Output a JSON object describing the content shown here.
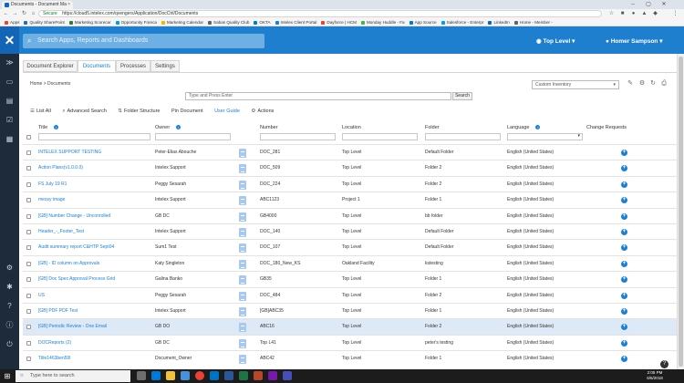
{
  "browser": {
    "tab_title": "Documents - Document Ma",
    "secure_label": "Secure",
    "url": "https://cloud5.intelex.com/qvengers/Application/DocCtrl/Documents",
    "bookmarks": [
      {
        "label": "Apps",
        "color": "#e94235"
      },
      {
        "label": "Quality SharePoint",
        "color": "#2b6cb0"
      },
      {
        "label": "Marketing Scorecar",
        "color": "#2e7d32"
      },
      {
        "label": "Opportunity Foreca",
        "color": "#00a1e0"
      },
      {
        "label": "Marketing Calendar",
        "color": "#f4b400"
      },
      {
        "label": "Sabas Quality Club",
        "color": "#5f6368"
      },
      {
        "label": "OKTA",
        "color": "#007dc1"
      },
      {
        "label": "Intelex Client Portal",
        "color": "#1f7fcf"
      },
      {
        "label": "Dayforce | HCM",
        "color": "#e94235"
      },
      {
        "label": "Monday Huddle - Fa",
        "color": "#4caf50"
      },
      {
        "label": "App Source",
        "color": "#0078d4"
      },
      {
        "label": "Salesforce - Enterpr",
        "color": "#00a1e0"
      },
      {
        "label": "LinkedIn",
        "color": "#0a66c2"
      },
      {
        "label": "Home - Member -",
        "color": "#5f6368"
      }
    ]
  },
  "header": {
    "search_placeholder": "Search Apps, Reports and Dashboards",
    "location": "Top Level",
    "user": "Homer Sampson"
  },
  "tabs": [
    "Document Explorer",
    "Documents",
    "Processes",
    "Settings"
  ],
  "breadcrumb": "Home > Documents",
  "filter": {
    "placeholder": "Type and Press Enter",
    "button": "Search"
  },
  "view_select": "Custom Inventory",
  "actions": {
    "list_all": "List All",
    "advanced_search": "Advanced Search",
    "folder_structure": "Folder Structure",
    "pin_document": "Pin Document",
    "user_guide": "User Guide",
    "actions": "Actions"
  },
  "columns": {
    "title": "Title",
    "owner": "Owner",
    "number": "Number",
    "location": "Location",
    "folder": "Folder",
    "language": "Language",
    "change_requests": "Change Requests"
  },
  "rows": [
    {
      "title": "INTELEX SUPPORT TESTING",
      "owner": "Peter-Elias Abouche",
      "number": "DOC_281",
      "location": "Top Level",
      "folder": "Default Folder",
      "language": "English (United States)"
    },
    {
      "title": "Action Plans(v1.0.0.0)",
      "owner": "Intelex Support",
      "number": "DOC_509",
      "location": "Top Level",
      "folder": "Folder 2",
      "language": "English (United States)"
    },
    {
      "title": "FS July 19 R1",
      "owner": "Peggy Sesarah",
      "number": "DOC_224",
      "location": "Top Level",
      "folder": "Folder 2",
      "language": "English (United States)"
    },
    {
      "title": "messy image",
      "owner": "Intelex Support",
      "number": "ABC1123",
      "location": "Project 1",
      "folder": "Folder 1",
      "language": "English (United States)"
    },
    {
      "title": "[GB] Number Change - Unconrolled",
      "owner": "GB DC",
      "number": "GB4000",
      "location": "Top Level",
      "folder": "bb folder",
      "language": "English (United States)"
    },
    {
      "title": "Header_-_Footer_Test",
      "owner": "Intelex Support",
      "number": "DOC_140",
      "location": "Top Level",
      "folder": "Default Folder",
      "language": "English (United States)"
    },
    {
      "title": "Audit summary report C&HTP Sept04",
      "owner": "Sum1 Test",
      "number": "DOC_107",
      "location": "Top Level",
      "folder": "Default Folder",
      "language": "English (United States)"
    },
    {
      "title": "[GB] - ID column on Approvals",
      "owner": "Katy Singleton",
      "number": "DOC_180_New_KS",
      "location": "Oakland Facility",
      "folder": "kstesting",
      "language": "English (United States)"
    },
    {
      "title": "[GB] Doc Spec Approval Process Grid",
      "owner": "Galina Banko",
      "number": "GB35",
      "location": "Top Level",
      "folder": "Folder 1",
      "language": "English (United States)"
    },
    {
      "title": "US",
      "owner": "Peggy Sesarah",
      "number": "DOC_484",
      "location": "Top Level",
      "folder": "Folder 2",
      "language": "English (United States)"
    },
    {
      "title": "[GB] PDF PDF Test",
      "owner": "Intelex Support",
      "number": "[GB]ABC35",
      "location": "Top Level",
      "folder": "Folder 1",
      "language": "English (United States)"
    },
    {
      "title": "[GB] Periodic Review - One Email",
      "owner": "GB DO",
      "number": "ABC16",
      "location": "Top Level",
      "folder": "Folder 2",
      "language": "English (United States)"
    },
    {
      "title": "DOCReports (2)",
      "owner": "GB DC",
      "number": "Top L41",
      "location": "Top Level",
      "folder": "peter's testing",
      "language": "English (United States)"
    },
    {
      "title": "Title1463ben50l",
      "owner": "Document_Owner",
      "number": "ABC42",
      "location": "Top Level",
      "folder": "Folder 1",
      "language": "English (United States)"
    }
  ],
  "taskbar": {
    "search_placeholder": "Type here to search",
    "time": "2:05 PM",
    "date": "6/6/2018"
  }
}
